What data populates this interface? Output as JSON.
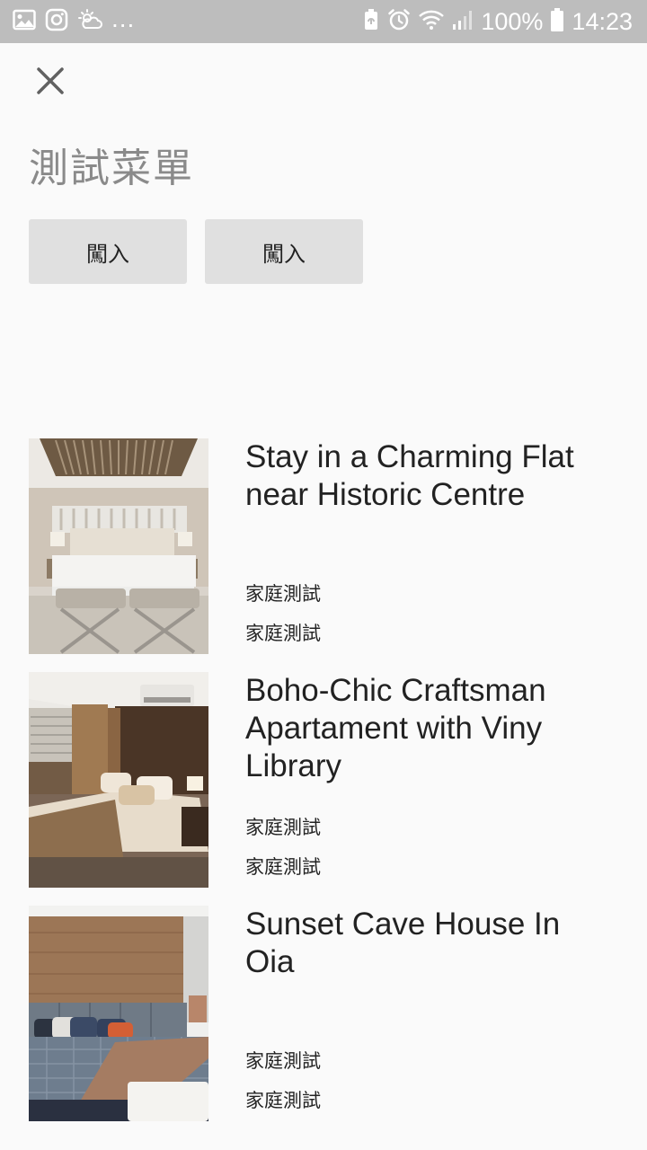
{
  "status_bar": {
    "overflow": "...",
    "battery_percent": "100%",
    "time": "14:23",
    "left_icons": [
      "gallery-icon",
      "instagram-icon",
      "weather-icon"
    ],
    "right_icons": [
      "battery-saver-icon",
      "alarm-icon",
      "wifi-icon",
      "signal-icon",
      "battery-icon"
    ]
  },
  "header": {
    "close_icon": "close-icon",
    "title": "測試菜單"
  },
  "actions": [
    {
      "label": "闖入"
    },
    {
      "label": "闖入"
    }
  ],
  "listings": [
    {
      "title": "Stay in a Charming Flat near Historic Centre",
      "subtitle_1": "家庭測試",
      "subtitle_2": "家庭測試",
      "image": "bedroom-photo-1"
    },
    {
      "title": "Boho-Chic Craftsman Apartament with Viny Library",
      "subtitle_1": "家庭測試",
      "subtitle_2": "家庭測試",
      "image": "bedroom-photo-2"
    },
    {
      "title": "Sunset Cave House In Oia",
      "subtitle_1": "家庭測試",
      "subtitle_2": "家庭測試",
      "image": "bedroom-photo-3"
    }
  ]
}
